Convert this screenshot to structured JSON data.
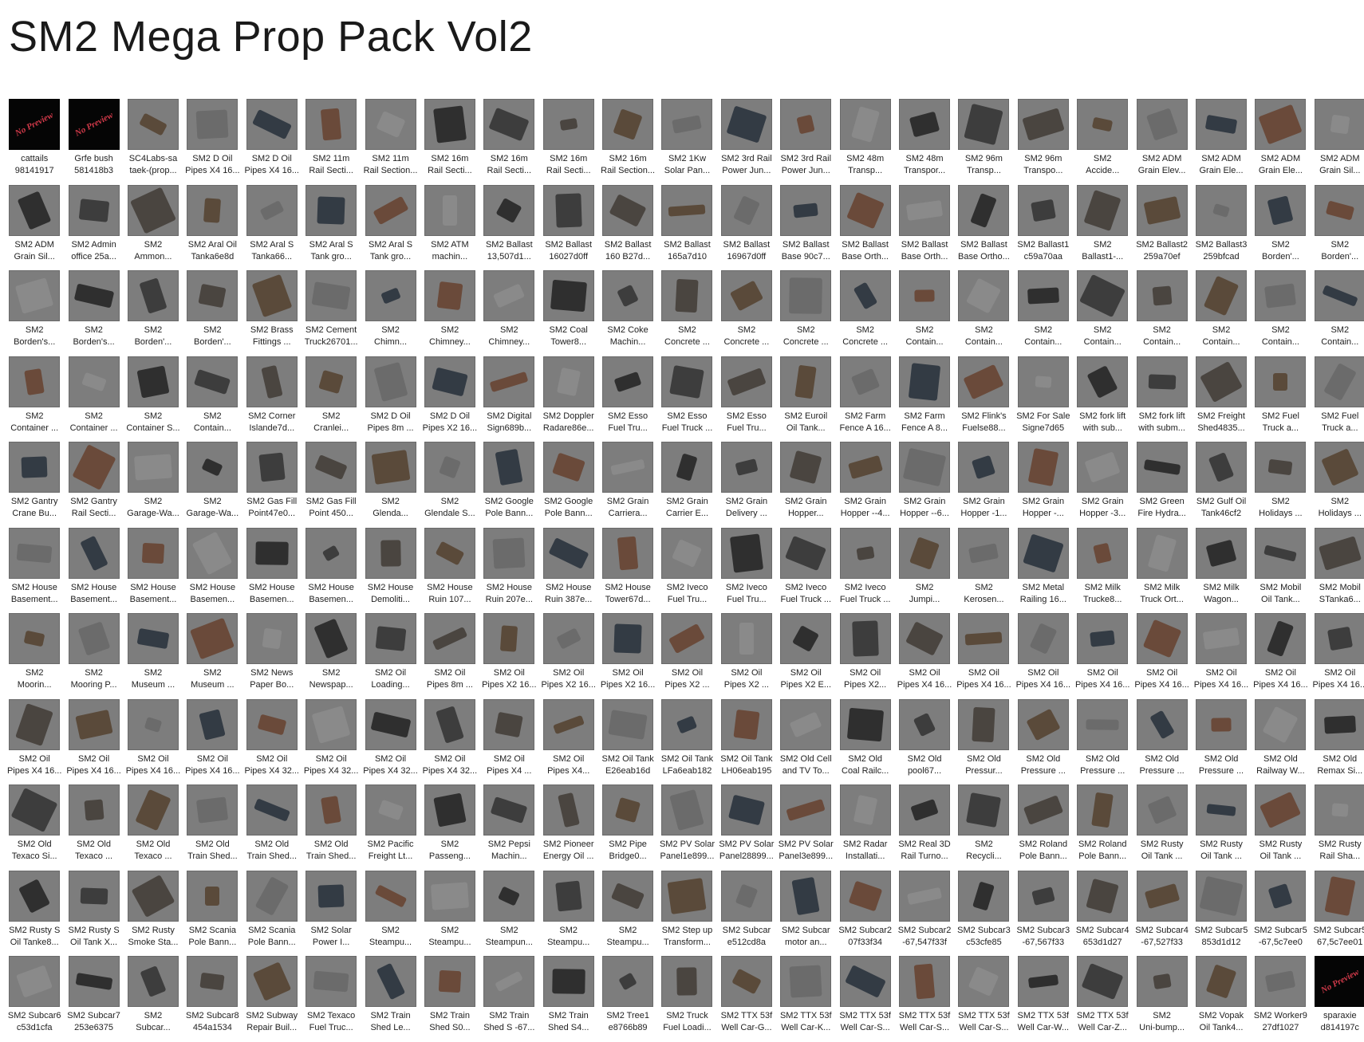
{
  "title": "SM2 Mega Prop Pack Vol2",
  "colors": {
    "tile_bg": "#7d7d7d",
    "no_preview_bg": "#050505",
    "no_preview_text": "#d23a4a"
  },
  "items": [
    {
      "l1": "cattails",
      "l2": "98141917",
      "np": true
    },
    {
      "l1": "Grfe bush",
      "l2": "581418b3",
      "np": true
    },
    {
      "l1": "SC4Labs-sa",
      "l2": "taek-(prop..."
    },
    {
      "l1": "SM2 D Oil",
      "l2": "Pipes X4 16..."
    },
    {
      "l1": "SM2 D Oil",
      "l2": "Pipes X4 16..."
    },
    {
      "l1": "SM2 11m",
      "l2": "Rail Secti..."
    },
    {
      "l1": "SM2 11m",
      "l2": "Rail Section..."
    },
    {
      "l1": "SM2 16m",
      "l2": "Rail Secti..."
    },
    {
      "l1": "SM2 16m",
      "l2": "Rail Secti..."
    },
    {
      "l1": "SM2 16m",
      "l2": "Rail Secti..."
    },
    {
      "l1": "SM2 16m",
      "l2": "Rail Section..."
    },
    {
      "l1": "SM2 1Kw",
      "l2": "Solar Pan..."
    },
    {
      "l1": "SM2 3rd Rail",
      "l2": "Power Jun..."
    },
    {
      "l1": "SM2 3rd Rail",
      "l2": "Power Jun..."
    },
    {
      "l1": "SM2 48m",
      "l2": "Transp..."
    },
    {
      "l1": "SM2 48m",
      "l2": "Transpor..."
    },
    {
      "l1": "SM2 96m",
      "l2": "Transp..."
    },
    {
      "l1": "SM2 96m",
      "l2": "Transpo..."
    },
    {
      "l1": "SM2",
      "l2": "Accide..."
    },
    {
      "l1": "SM2 ADM",
      "l2": "Grain Elev..."
    },
    {
      "l1": "SM2 ADM",
      "l2": "Grain Ele..."
    },
    {
      "l1": "SM2 ADM",
      "l2": "Grain Ele..."
    },
    {
      "l1": "SM2 ADM",
      "l2": "Grain Sil..."
    },
    {
      "l1": "SM2 ADM",
      "l2": "Grain Sil..."
    },
    {
      "l1": "SM2 Admin",
      "l2": "office 25a..."
    },
    {
      "l1": "SM2",
      "l2": "Ammon..."
    },
    {
      "l1": "SM2 Aral Oil",
      "l2": "Tanka6e8d"
    },
    {
      "l1": "SM2 Aral S",
      "l2": "Tanka66..."
    },
    {
      "l1": "SM2 Aral S",
      "l2": "Tank gro..."
    },
    {
      "l1": "SM2 Aral S",
      "l2": "Tank gro..."
    },
    {
      "l1": "SM2 ATM",
      "l2": "machin..."
    },
    {
      "l1": "SM2 Ballast",
      "l2": "13,507d1..."
    },
    {
      "l1": "SM2 Ballast",
      "l2": "16027d0ff"
    },
    {
      "l1": "SM2 Ballast",
      "l2": "160 B27d..."
    },
    {
      "l1": "SM2 Ballast",
      "l2": "165a7d10"
    },
    {
      "l1": "SM2 Ballast",
      "l2": "16967d0ff"
    },
    {
      "l1": "SM2 Ballast",
      "l2": "Base 90c7..."
    },
    {
      "l1": "SM2 Ballast",
      "l2": "Base Orth..."
    },
    {
      "l1": "SM2 Ballast",
      "l2": "Base Orth..."
    },
    {
      "l1": "SM2 Ballast",
      "l2": "Base Ortho..."
    },
    {
      "l1": "SM2 Ballast1",
      "l2": "c59a70aa"
    },
    {
      "l1": "SM2",
      "l2": "Ballast1-..."
    },
    {
      "l1": "SM2 Ballast2",
      "l2": "259a70ef"
    },
    {
      "l1": "SM2 Ballast3",
      "l2": "259bfcad"
    },
    {
      "l1": "SM2",
      "l2": "Borden'..."
    },
    {
      "l1": "SM2",
      "l2": "Borden'..."
    },
    {
      "l1": "SM2",
      "l2": "Borden's..."
    },
    {
      "l1": "SM2",
      "l2": "Borden's..."
    },
    {
      "l1": "SM2",
      "l2": "Borden'..."
    },
    {
      "l1": "SM2",
      "l2": "Borden'..."
    },
    {
      "l1": "SM2 Brass",
      "l2": "Fittings ..."
    },
    {
      "l1": "SM2 Cement",
      "l2": "Truck26701..."
    },
    {
      "l1": "SM2",
      "l2": "Chimn..."
    },
    {
      "l1": "SM2",
      "l2": "Chimney..."
    },
    {
      "l1": "SM2",
      "l2": "Chimney..."
    },
    {
      "l1": "SM2 Coal",
      "l2": "Tower8..."
    },
    {
      "l1": "SM2 Coke",
      "l2": "Machin..."
    },
    {
      "l1": "SM2",
      "l2": "Concrete ..."
    },
    {
      "l1": "SM2",
      "l2": "Concrete ..."
    },
    {
      "l1": "SM2",
      "l2": "Concrete ..."
    },
    {
      "l1": "SM2",
      "l2": "Concrete ..."
    },
    {
      "l1": "SM2",
      "l2": "Contain..."
    },
    {
      "l1": "SM2",
      "l2": "Contain..."
    },
    {
      "l1": "SM2",
      "l2": "Contain..."
    },
    {
      "l1": "SM2",
      "l2": "Contain..."
    },
    {
      "l1": "SM2",
      "l2": "Contain..."
    },
    {
      "l1": "SM2",
      "l2": "Contain..."
    },
    {
      "l1": "SM2",
      "l2": "Contain..."
    },
    {
      "l1": "SM2",
      "l2": "Contain..."
    },
    {
      "l1": "SM2",
      "l2": "Container ..."
    },
    {
      "l1": "SM2",
      "l2": "Container ..."
    },
    {
      "l1": "SM2",
      "l2": "Container S..."
    },
    {
      "l1": "SM2",
      "l2": "Contain..."
    },
    {
      "l1": "SM2 Corner",
      "l2": "Islande7d..."
    },
    {
      "l1": "SM2",
      "l2": "Cranlei..."
    },
    {
      "l1": "SM2 D Oil",
      "l2": "Pipes 8m ..."
    },
    {
      "l1": "SM2 D Oil",
      "l2": "Pipes X2 16..."
    },
    {
      "l1": "SM2 Digital",
      "l2": "Sign689b..."
    },
    {
      "l1": "SM2 Doppler",
      "l2": "Radare86e..."
    },
    {
      "l1": "SM2 Esso",
      "l2": "Fuel Tru..."
    },
    {
      "l1": "SM2 Esso",
      "l2": "Fuel Truck ..."
    },
    {
      "l1": "SM2 Esso",
      "l2": "Fuel Tru..."
    },
    {
      "l1": "SM2 Euroil",
      "l2": "Oil Tank..."
    },
    {
      "l1": "SM2 Farm",
      "l2": "Fence A 16..."
    },
    {
      "l1": "SM2 Farm",
      "l2": "Fence A 8..."
    },
    {
      "l1": "SM2 Flink's",
      "l2": "Fuelse88..."
    },
    {
      "l1": "SM2 For Sale",
      "l2": "Signe7d65"
    },
    {
      "l1": "SM2 fork lift",
      "l2": "with sub..."
    },
    {
      "l1": "SM2 fork lift",
      "l2": "with subm..."
    },
    {
      "l1": "SM2 Freight",
      "l2": "Shed4835..."
    },
    {
      "l1": "SM2 Fuel",
      "l2": "Truck a..."
    },
    {
      "l1": "SM2 Fuel",
      "l2": "Truck a..."
    },
    {
      "l1": "SM2 Gantry",
      "l2": "Crane Bu..."
    },
    {
      "l1": "SM2 Gantry",
      "l2": "Rail Secti..."
    },
    {
      "l1": "SM2",
      "l2": "Garage-Wa..."
    },
    {
      "l1": "SM2",
      "l2": "Garage-Wa..."
    },
    {
      "l1": "SM2 Gas Fill",
      "l2": "Point47e0..."
    },
    {
      "l1": "SM2 Gas Fill",
      "l2": "Point 450..."
    },
    {
      "l1": "SM2",
      "l2": "Glenda..."
    },
    {
      "l1": "SM2",
      "l2": "Glendale S..."
    },
    {
      "l1": "SM2 Google",
      "l2": "Pole Bann..."
    },
    {
      "l1": "SM2 Google",
      "l2": "Pole Bann..."
    },
    {
      "l1": "SM2 Grain",
      "l2": "Carriera..."
    },
    {
      "l1": "SM2 Grain",
      "l2": "Carrier E..."
    },
    {
      "l1": "SM2 Grain",
      "l2": "Delivery ..."
    },
    {
      "l1": "SM2 Grain",
      "l2": "Hopper..."
    },
    {
      "l1": "SM2 Grain",
      "l2": "Hopper --4..."
    },
    {
      "l1": "SM2 Grain",
      "l2": "Hopper --6..."
    },
    {
      "l1": "SM2 Grain",
      "l2": "Hopper -1..."
    },
    {
      "l1": "SM2 Grain",
      "l2": "Hopper -..."
    },
    {
      "l1": "SM2 Grain",
      "l2": "Hopper -3..."
    },
    {
      "l1": "SM2 Green",
      "l2": "Fire Hydra..."
    },
    {
      "l1": "SM2 Gulf Oil",
      "l2": "Tank46cf2"
    },
    {
      "l1": "SM2",
      "l2": "Holidays ..."
    },
    {
      "l1": "SM2",
      "l2": "Holidays ..."
    },
    {
      "l1": "SM2 House",
      "l2": "Basement..."
    },
    {
      "l1": "SM2 House",
      "l2": "Basement..."
    },
    {
      "l1": "SM2 House",
      "l2": "Basement..."
    },
    {
      "l1": "SM2 House",
      "l2": "Basemen..."
    },
    {
      "l1": "SM2 House",
      "l2": "Basemen..."
    },
    {
      "l1": "SM2 House",
      "l2": "Basemen..."
    },
    {
      "l1": "SM2 House",
      "l2": "Demoliti..."
    },
    {
      "l1": "SM2 House",
      "l2": "Ruin 107..."
    },
    {
      "l1": "SM2 House",
      "l2": "Ruin 207e..."
    },
    {
      "l1": "SM2 House",
      "l2": "Ruin 387e..."
    },
    {
      "l1": "SM2 House",
      "l2": "Tower67d..."
    },
    {
      "l1": "SM2 Iveco",
      "l2": "Fuel Tru..."
    },
    {
      "l1": "SM2 Iveco",
      "l2": "Fuel Tru..."
    },
    {
      "l1": "SM2 Iveco",
      "l2": "Fuel Truck ..."
    },
    {
      "l1": "SM2 Iveco",
      "l2": "Fuel Truck ..."
    },
    {
      "l1": "SM2",
      "l2": "Jumpi..."
    },
    {
      "l1": "SM2",
      "l2": "Kerosen..."
    },
    {
      "l1": "SM2 Metal",
      "l2": "Railing 16..."
    },
    {
      "l1": "SM2 Milk",
      "l2": "Trucke8..."
    },
    {
      "l1": "SM2 Milk",
      "l2": "Truck Ort..."
    },
    {
      "l1": "SM2 Milk",
      "l2": "Wagon..."
    },
    {
      "l1": "SM2 Mobil",
      "l2": "Oil Tank..."
    },
    {
      "l1": "SM2 Mobil",
      "l2": "STanka6..."
    },
    {
      "l1": "SM2",
      "l2": "Moorin..."
    },
    {
      "l1": "SM2",
      "l2": "Mooring P..."
    },
    {
      "l1": "SM2",
      "l2": "Museum ..."
    },
    {
      "l1": "SM2",
      "l2": "Museum ..."
    },
    {
      "l1": "SM2 News",
      "l2": "Paper Bo..."
    },
    {
      "l1": "SM2",
      "l2": "Newspap..."
    },
    {
      "l1": "SM2 Oil",
      "l2": "Loading..."
    },
    {
      "l1": "SM2 Oil",
      "l2": "Pipes 8m ..."
    },
    {
      "l1": "SM2 Oil",
      "l2": "Pipes X2 16..."
    },
    {
      "l1": "SM2 Oil",
      "l2": "Pipes X2 16..."
    },
    {
      "l1": "SM2 Oil",
      "l2": "Pipes X2 16..."
    },
    {
      "l1": "SM2 Oil",
      "l2": "Pipes X2 ..."
    },
    {
      "l1": "SM2 Oil",
      "l2": "Pipes X2 ..."
    },
    {
      "l1": "SM2 Oil",
      "l2": "Pipes X2 E..."
    },
    {
      "l1": "SM2 Oil",
      "l2": "Pipes X2..."
    },
    {
      "l1": "SM2 Oil",
      "l2": "Pipes X4 16..."
    },
    {
      "l1": "SM2 Oil",
      "l2": "Pipes X4 16..."
    },
    {
      "l1": "SM2 Oil",
      "l2": "Pipes X4 16..."
    },
    {
      "l1": "SM2 Oil",
      "l2": "Pipes X4 16..."
    },
    {
      "l1": "SM2 Oil",
      "l2": "Pipes X4 16..."
    },
    {
      "l1": "SM2 Oil",
      "l2": "Pipes X4 16..."
    },
    {
      "l1": "SM2 Oil",
      "l2": "Pipes X4 16..."
    },
    {
      "l1": "SM2 Oil",
      "l2": "Pipes X4 16..."
    },
    {
      "l1": "SM2 Oil",
      "l2": "Pipes X4 16..."
    },
    {
      "l1": "SM2 Oil",
      "l2": "Pipes X4 16..."
    },
    {
      "l1": "SM2 Oil",
      "l2": "Pipes X4 16..."
    },
    {
      "l1": "SM2 Oil",
      "l2": "Pipes X4 16..."
    },
    {
      "l1": "SM2 Oil",
      "l2": "Pipes X4 32..."
    },
    {
      "l1": "SM2 Oil",
      "l2": "Pipes X4 32..."
    },
    {
      "l1": "SM2 Oil",
      "l2": "Pipes X4 32..."
    },
    {
      "l1": "SM2 Oil",
      "l2": "Pipes X4 32..."
    },
    {
      "l1": "SM2 Oil",
      "l2": "Pipes X4 ..."
    },
    {
      "l1": "SM2 Oil",
      "l2": "Pipes X4..."
    },
    {
      "l1": "SM2 Oil Tank",
      "l2": "E26eab16d"
    },
    {
      "l1": "SM2 Oil Tank",
      "l2": "LFa6eab182"
    },
    {
      "l1": "SM2 Oil Tank",
      "l2": "LH06eab195"
    },
    {
      "l1": "SM2 Old Cell",
      "l2": "and TV To..."
    },
    {
      "l1": "SM2 Old",
      "l2": "Coal Railc..."
    },
    {
      "l1": "SM2 Old",
      "l2": "pool67..."
    },
    {
      "l1": "SM2 Old",
      "l2": "Pressur..."
    },
    {
      "l1": "SM2 Old",
      "l2": "Pressure ..."
    },
    {
      "l1": "SM2 Old",
      "l2": "Pressure ..."
    },
    {
      "l1": "SM2 Old",
      "l2": "Pressure ..."
    },
    {
      "l1": "SM2 Old",
      "l2": "Pressure ..."
    },
    {
      "l1": "SM2 Old",
      "l2": "Railway W..."
    },
    {
      "l1": "SM2 Old",
      "l2": "Remax Si..."
    },
    {
      "l1": "SM2 Old",
      "l2": "Texaco Si..."
    },
    {
      "l1": "SM2 Old",
      "l2": "Texaco ..."
    },
    {
      "l1": "SM2 Old",
      "l2": "Texaco ..."
    },
    {
      "l1": "SM2 Old",
      "l2": "Train Shed..."
    },
    {
      "l1": "SM2 Old",
      "l2": "Train Shed..."
    },
    {
      "l1": "SM2 Old",
      "l2": "Train Shed..."
    },
    {
      "l1": "SM2 Pacific",
      "l2": "Freight Lt..."
    },
    {
      "l1": "SM2",
      "l2": "Passeng..."
    },
    {
      "l1": "SM2 Pepsi",
      "l2": "Machin..."
    },
    {
      "l1": "SM2 Pioneer",
      "l2": "Energy Oil ..."
    },
    {
      "l1": "SM2 Pipe",
      "l2": "Bridge0..."
    },
    {
      "l1": "SM2 PV Solar",
      "l2": "Panel1e899..."
    },
    {
      "l1": "SM2 PV Solar",
      "l2": "Panel28899..."
    },
    {
      "l1": "SM2 PV Solar",
      "l2": "Panel3e899..."
    },
    {
      "l1": "SM2 Radar",
      "l2": "Installati..."
    },
    {
      "l1": "SM2 Real 3D",
      "l2": "Rail Turno..."
    },
    {
      "l1": "SM2",
      "l2": "Recycli..."
    },
    {
      "l1": "SM2 Roland",
      "l2": "Pole Bann..."
    },
    {
      "l1": "SM2 Roland",
      "l2": "Pole Bann..."
    },
    {
      "l1": "SM2 Rusty",
      "l2": "Oil Tank ..."
    },
    {
      "l1": "SM2 Rusty",
      "l2": "Oil Tank ..."
    },
    {
      "l1": "SM2 Rusty",
      "l2": "Oil Tank ..."
    },
    {
      "l1": "SM2 Rusty",
      "l2": "Rail Sha..."
    },
    {
      "l1": "SM2 Rusty S",
      "l2": "Oil Tanke8..."
    },
    {
      "l1": "SM2 Rusty S",
      "l2": "Oil Tank X..."
    },
    {
      "l1": "SM2 Rusty",
      "l2": "Smoke Sta..."
    },
    {
      "l1": "SM2 Scania",
      "l2": "Pole Bann..."
    },
    {
      "l1": "SM2 Scania",
      "l2": "Pole Bann..."
    },
    {
      "l1": "SM2 Solar",
      "l2": "Power I..."
    },
    {
      "l1": "SM2",
      "l2": "Steampu..."
    },
    {
      "l1": "SM2",
      "l2": "Steampu..."
    },
    {
      "l1": "SM2",
      "l2": "Steampun..."
    },
    {
      "l1": "SM2",
      "l2": "Steampu..."
    },
    {
      "l1": "SM2",
      "l2": "Steampu..."
    },
    {
      "l1": "SM2 Step up",
      "l2": "Transform..."
    },
    {
      "l1": "SM2 Subcar",
      "l2": "e512cd8a"
    },
    {
      "l1": "SM2 Subcar",
      "l2": "motor an..."
    },
    {
      "l1": "SM2 Subcar2",
      "l2": "07f33f34"
    },
    {
      "l1": "SM2 Subcar2",
      "l2": "-67,547f33f"
    },
    {
      "l1": "SM2 Subcar3",
      "l2": "c53cfe85"
    },
    {
      "l1": "SM2 Subcar3",
      "l2": "-67,567f33"
    },
    {
      "l1": "SM2 Subcar4",
      "l2": "653d1d27"
    },
    {
      "l1": "SM2 Subcar4",
      "l2": "-67,527f33"
    },
    {
      "l1": "SM2 Subcar5",
      "l2": "853d1d12"
    },
    {
      "l1": "SM2 Subcar5",
      "l2": "-67,5c7ee0"
    },
    {
      "l1": "SM2 Subcar5",
      "l2": "67,5c7ee01"
    },
    {
      "l1": "SM2 Subcar6",
      "l2": "c53d1cfa"
    },
    {
      "l1": "SM2 Subcar7",
      "l2": "253e6375"
    },
    {
      "l1": "SM2",
      "l2": "Subcar..."
    },
    {
      "l1": "SM2 Subcar8",
      "l2": "454a1534"
    },
    {
      "l1": "SM2 Subway",
      "l2": "Repair Buil..."
    },
    {
      "l1": "SM2 Texaco",
      "l2": "Fuel Truc..."
    },
    {
      "l1": "SM2 Train",
      "l2": "Shed Le..."
    },
    {
      "l1": "SM2 Train",
      "l2": "Shed S0..."
    },
    {
      "l1": "SM2 Train",
      "l2": "Shed S -67..."
    },
    {
      "l1": "SM2 Train",
      "l2": "Shed S4..."
    },
    {
      "l1": "SM2 Tree1",
      "l2": "e8766b89"
    },
    {
      "l1": "SM2 Truck",
      "l2": "Fuel Loadi..."
    },
    {
      "l1": "SM2 TTX 53f",
      "l2": "Well Car-G..."
    },
    {
      "l1": "SM2 TTX 53f",
      "l2": "Well Car-K..."
    },
    {
      "l1": "SM2 TTX 53f",
      "l2": "Well Car-S..."
    },
    {
      "l1": "SM2 TTX 53f",
      "l2": "Well Car-S..."
    },
    {
      "l1": "SM2 TTX 53f",
      "l2": "Well Car-S..."
    },
    {
      "l1": "SM2 TTX 53f",
      "l2": "Well Car-W..."
    },
    {
      "l1": "SM2 TTX 53f",
      "l2": "Well Car-Z..."
    },
    {
      "l1": "SM2",
      "l2": "Uni-bump..."
    },
    {
      "l1": "SM2 Vopak",
      "l2": "Oil Tank4..."
    },
    {
      "l1": "SM2 Worker9",
      "l2": "27df1027"
    },
    {
      "l1": "sparaxie",
      "l2": "d814197c",
      "np": true
    }
  ],
  "no_preview_label": "No Preview"
}
